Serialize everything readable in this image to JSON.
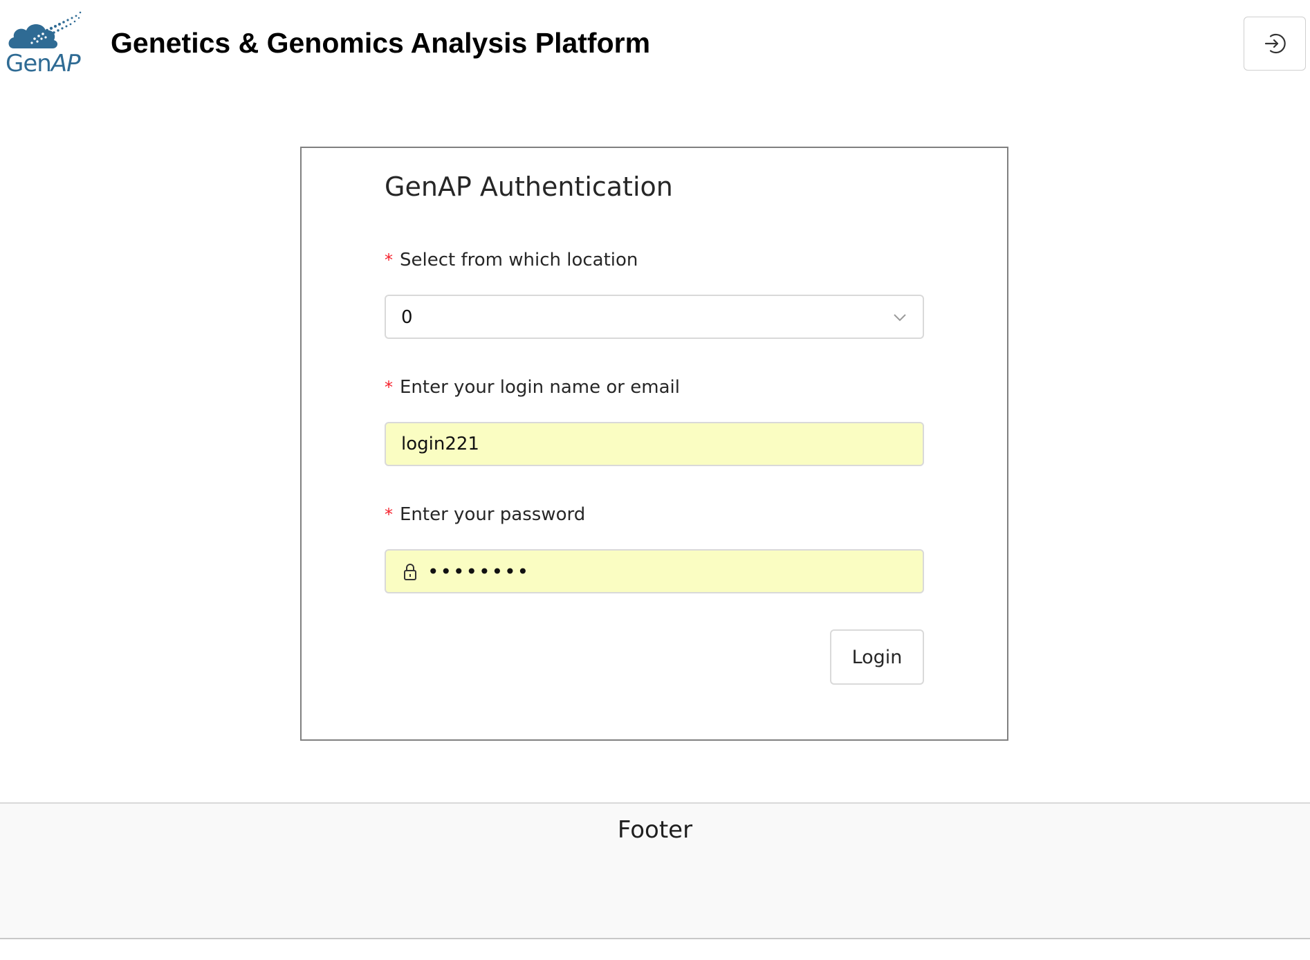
{
  "header": {
    "logo": {
      "text_main": "Gen",
      "text_accent": "AP",
      "icon": "cloud-dna-logo-icon",
      "color": "#2f6b94"
    },
    "title": "Genetics & Genomics Analysis Platform",
    "signin_icon": "login-arrow-icon"
  },
  "auth": {
    "title": "GenAP Authentication",
    "required_marker": "*",
    "location": {
      "label": "Select from which location",
      "selected_value": "0",
      "icon": "chevron-down-icon"
    },
    "login_name": {
      "label": "Enter your login name or email",
      "value": "login221"
    },
    "password": {
      "label": "Enter your password",
      "value": "••••••••",
      "icon": "lock-icon"
    },
    "login_button_label": "Login"
  },
  "footer": {
    "text": "Footer"
  },
  "colors": {
    "required": "#f5222d",
    "autofill_background": "#fafdc2",
    "border": "#d9d9d9",
    "card_border": "#808080"
  }
}
